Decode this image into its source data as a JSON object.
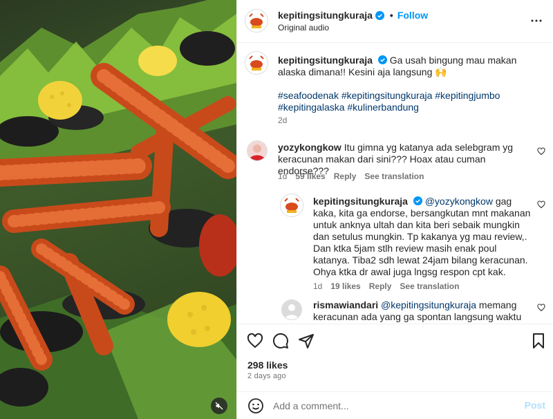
{
  "header": {
    "username": "kepitingsitungkuraja",
    "follow_label": "Follow",
    "audio_label": "Original audio",
    "dot": "•"
  },
  "caption": {
    "username": "kepitingsitungkuraja",
    "text": "Ga usah bingung mau makan alaska dimana!! Kesini aja langsung 🙌",
    "hashtags": "#seafoodenak #kepitingsitungkuraja #kepitingjumbo #kepitingalaska #kulinerbandung",
    "time": "2d"
  },
  "comments": [
    {
      "username": "yozykongkow",
      "text": "Itu gimna yg katanya ada selebgram yg keracunan makan dari sini??? Hoax atau cuman endorse???",
      "time": "1d",
      "likes": "59 likes",
      "reply_label": "Reply",
      "translation_label": "See translation"
    },
    {
      "username": "kepitingsitungkuraja",
      "mention": "@yozykongkow",
      "text": "gag kaka, kita ga endorse, bersangkutan mnt makanan untuk anknya ultah dan kita beri sebaik mungkin dan setulus mungkin. Tp kakanya yg mau review,. Dan ktka 5jam stlh review masih enak poul katanya. Tiba2 sdh lewat 24jam bilang keracunan. Ohya ktka dr awal juga lngsg respon cpt kak.",
      "time": "1d",
      "likes": "19 likes",
      "reply_label": "Reply",
      "translation_label": "See translation"
    },
    {
      "username": "rismawiandari",
      "mention": "@kepitingsitungkuraja",
      "text": "memang keracunan ada yang ga spontan langsung waktu itu"
    }
  ],
  "actions": {
    "likes": "298 likes",
    "time_ago": "2 days ago"
  },
  "add_comment": {
    "placeholder": "Add a comment...",
    "post_label": "Post"
  },
  "colors": {
    "accent": "#0095f6",
    "link": "#00376b",
    "muted": "#737373",
    "post_disabled": "#b2dffc"
  }
}
